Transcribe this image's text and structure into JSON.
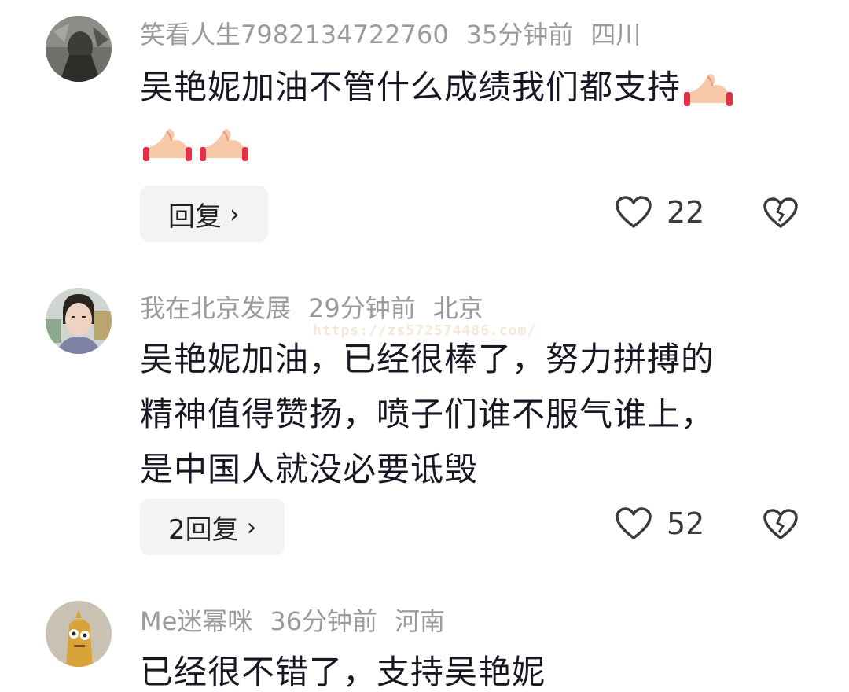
{
  "comments": [
    {
      "username": "笑看人生7982134722760",
      "time": "35分钟前",
      "location": "四川",
      "text_line1": "吴艳妮加油不管什么成绩我们都支持",
      "emoji": "waving-hand-emoji",
      "reply_label": "回复",
      "likes": "22"
    },
    {
      "username": "我在北京发展",
      "time": "29分钟前",
      "location": "北京",
      "lines": [
        "吴艳妮加油，已经很棒了，努力拼搏的",
        "精神值得赞扬，喷子们谁不服气谁上，",
        "是中国人就没必要诋毁"
      ],
      "reply_label": "2回复",
      "likes": "52"
    },
    {
      "username": "Me迷幂咪",
      "time": "36分钟前",
      "location": "河南",
      "text": "已经很不错了，支持吴艳妮"
    }
  ],
  "watermark": "https://zs572574486.com/",
  "icons": {
    "chevron": "chevron-right-icon",
    "like": "heart-outline-icon",
    "dislike": "broken-heart-icon"
  },
  "colors": {
    "meta_text": "#9a9a9f",
    "body_text": "#161823",
    "reply_bg": "#f3f3f5"
  }
}
